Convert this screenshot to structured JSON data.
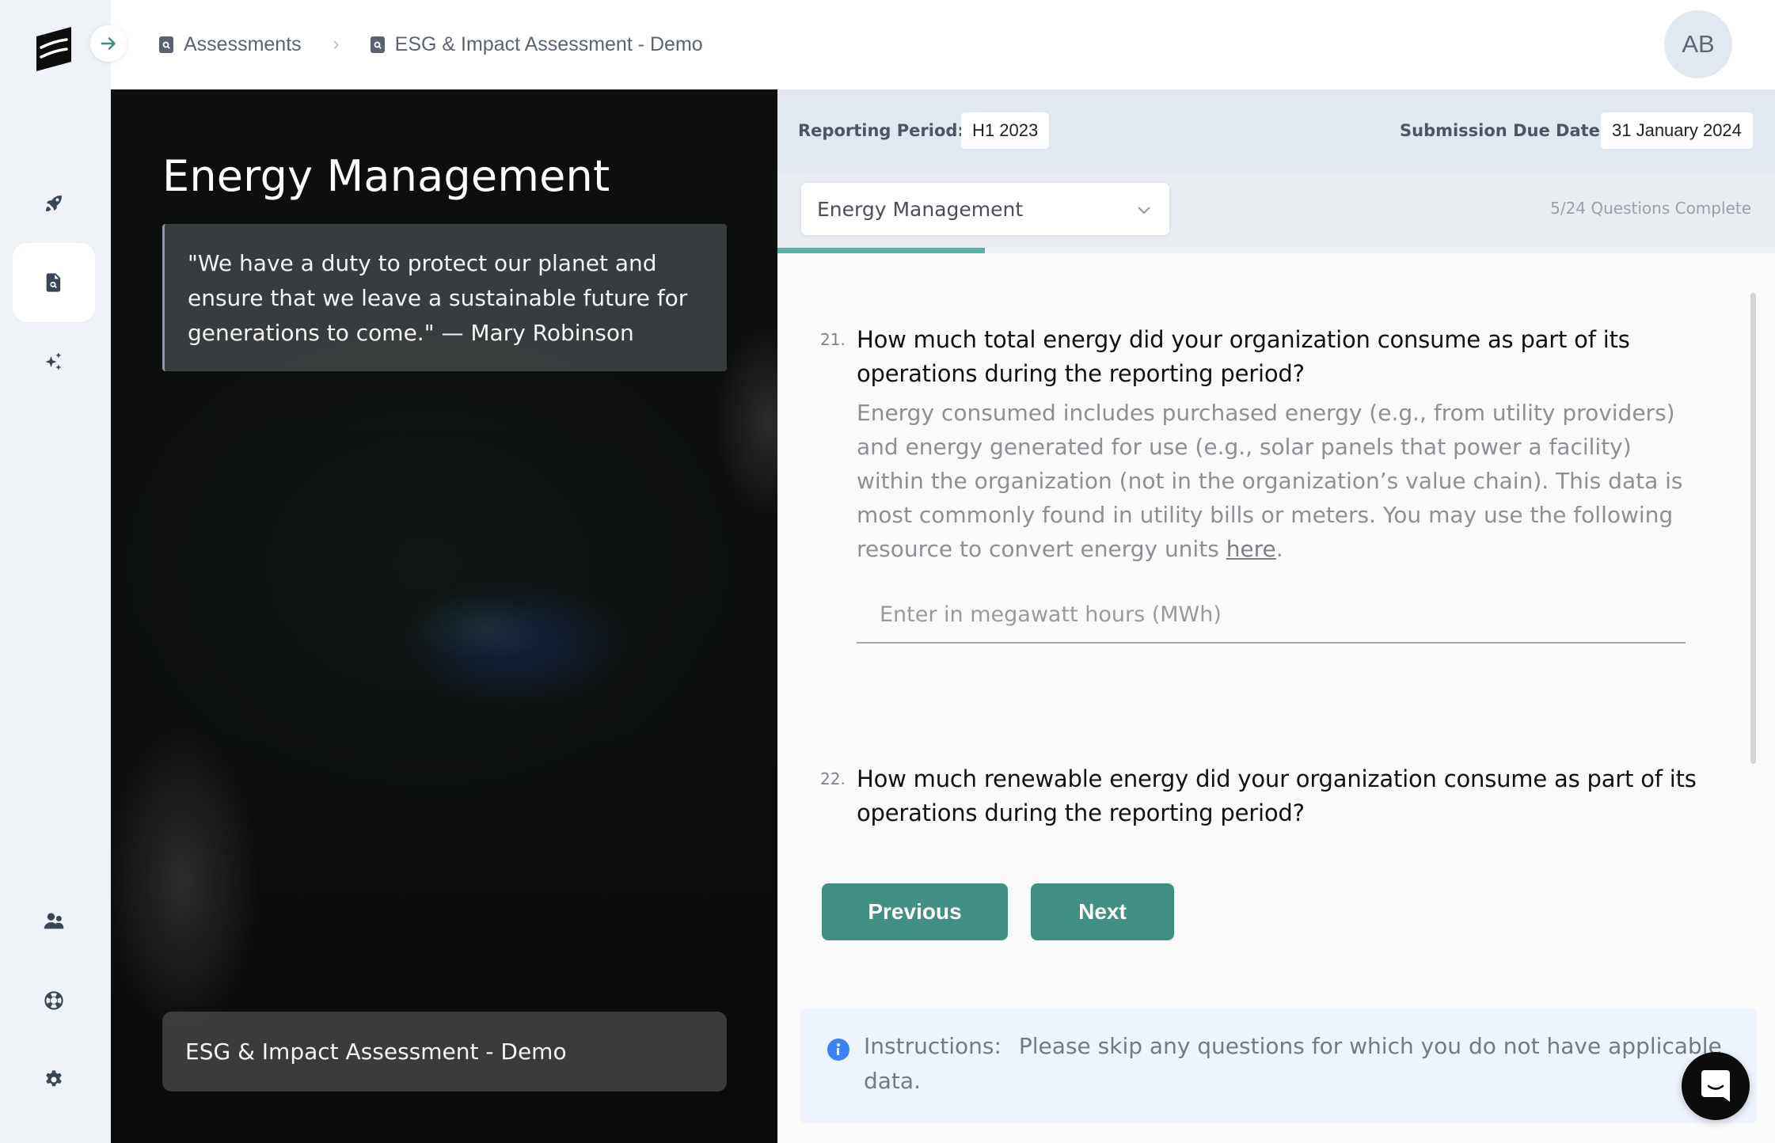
{
  "app": {
    "logo_icon": "brand-logo-icon",
    "collapse_icon": "arrow-right-icon"
  },
  "sidebar": {
    "items": [
      {
        "id": "getting-started",
        "icon": "rocket-icon",
        "active": false
      },
      {
        "id": "assessments",
        "icon": "file-search-icon",
        "active": true
      },
      {
        "id": "ai-features",
        "icon": "sparkles-icon",
        "active": false
      },
      {
        "id": "team",
        "icon": "users-icon",
        "active": false
      },
      {
        "id": "support",
        "icon": "life-ring-icon",
        "active": false
      },
      {
        "id": "settings",
        "icon": "gear-icon",
        "active": false
      }
    ]
  },
  "header": {
    "breadcrumb": [
      {
        "label": "Assessments",
        "icon": "file-search-icon"
      },
      {
        "label": "ESG & Impact Assessment - Demo",
        "icon": "file-search-icon"
      }
    ],
    "separator": "›",
    "avatar_initials": "AB"
  },
  "hero": {
    "title": "Energy Management",
    "quote": "\"We have a duty to protect our planet and ensure that we leave a sustainable future for generations to come.\" — Mary Robinson",
    "assessment_name": "ESG & Impact Assessment - Demo"
  },
  "form": {
    "reporting_period_label": "Reporting Period:",
    "reporting_period_value": "H1 2023",
    "due_date_label": "Submission Due Date:",
    "due_date_value": "31 January 2024",
    "section_select_value": "Energy Management",
    "progress": {
      "completed": 5,
      "total": 24,
      "label": "5/24 Questions Complete",
      "fraction": 0.208
    },
    "questions": [
      {
        "number": "21.",
        "text": "How much total energy did your organization consume as part of its operations during the reporting period?",
        "description_before_link": "Energy consumed includes purchased energy (e.g., from utility providers) and energy generated for use (e.g., solar panels that power a facility) within the organization (not in the organization’s value chain). This data is most commonly found in utility bills or meters. You may use the following resource to convert energy units ",
        "link_text": "here",
        "description_after_link": ".",
        "input_placeholder": "Enter in megawatt hours (MWh)",
        "input_value": ""
      },
      {
        "number": "22.",
        "text": "How much renewable energy did your organization consume as part of its operations during the reporting period?"
      }
    ],
    "previous_label": "Previous",
    "next_label": "Next",
    "instructions_label": "Instructions:",
    "instructions_text": "Please skip any questions for which you do not have applicable data."
  },
  "colors": {
    "accent": "#428f83",
    "progress": "#52b4a2",
    "info": "#3b82f6"
  },
  "chat": {
    "icon": "chat-bubble-icon"
  }
}
